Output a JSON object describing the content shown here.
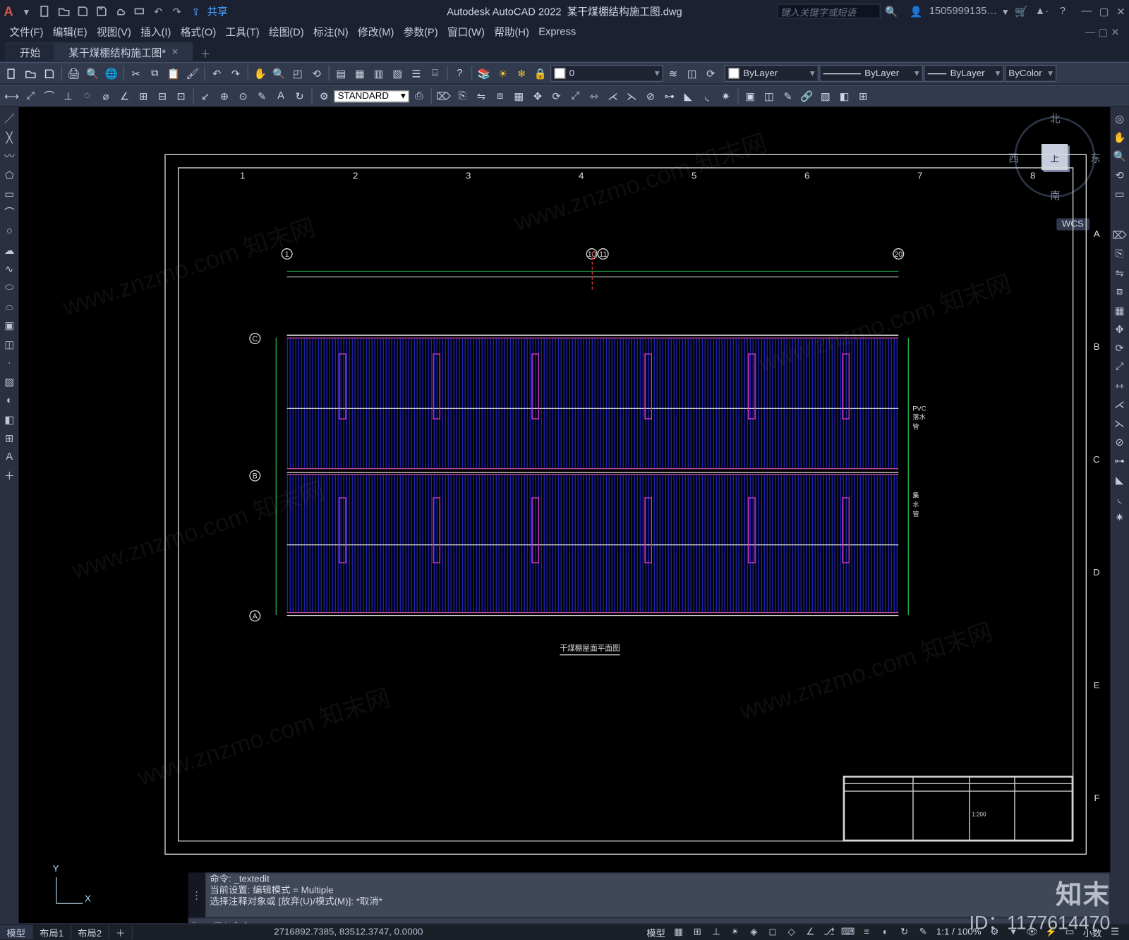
{
  "titlebar": {
    "app_title": "Autodesk AutoCAD 2022",
    "doc_title": "某干煤棚结构施工图.dwg",
    "share": "共享",
    "search_placeholder": "键入关键字或短语",
    "user": "1505999135…",
    "logo": "A"
  },
  "menu": [
    "文件(F)",
    "编辑(E)",
    "视图(V)",
    "插入(I)",
    "格式(O)",
    "工具(T)",
    "绘图(D)",
    "标注(N)",
    "修改(M)",
    "参数(P)",
    "窗口(W)",
    "帮助(H)",
    "Express"
  ],
  "tabs": {
    "start": "开始",
    "active": "某干煤棚结构施工图*"
  },
  "toolbar1": {
    "layer_sel": "0",
    "bylayer1": "ByLayer",
    "bylayer2": "ByLayer",
    "bylayer3": "ByLayer",
    "bycolor": "ByColor"
  },
  "toolbar2": {
    "std": "STANDARD"
  },
  "viewcube": {
    "top": "上",
    "n": "北",
    "s": "南",
    "e": "东",
    "w": "西",
    "wcs": "WCS"
  },
  "drawing": {
    "title": "干煤棚屋面平面图",
    "note1": "PVC落水管",
    "note2": "集水管",
    "cols": [
      "1",
      "2",
      "3",
      "4",
      "5",
      "6",
      "7",
      "8"
    ],
    "rows": [
      "A",
      "B",
      "C",
      "D",
      "E",
      "F"
    ],
    "grid_bubbles_top": [
      "1",
      "10",
      "11",
      "20"
    ],
    "grid_bubbles_left": [
      "C",
      "B",
      "A"
    ],
    "scale": "1:200"
  },
  "cmd": {
    "l1": "命令: _textedit",
    "l2": "当前设置: 编辑模式 = Multiple",
    "l3": "选择注释对象或 [放弃(U)/模式(M)]: *取消*",
    "prompt": "键入命令"
  },
  "layout_tabs": [
    "模型",
    "布局1",
    "布局2"
  ],
  "status": {
    "coords": "2716892.7385, 83512.3747, 0.0000",
    "model": "模型",
    "scale": "1:1 / 100%",
    "dec": "小数"
  },
  "watermark": {
    "brand": "知末",
    "id": "ID：1177614470",
    "url": "www.znzmo.com 知末网"
  }
}
